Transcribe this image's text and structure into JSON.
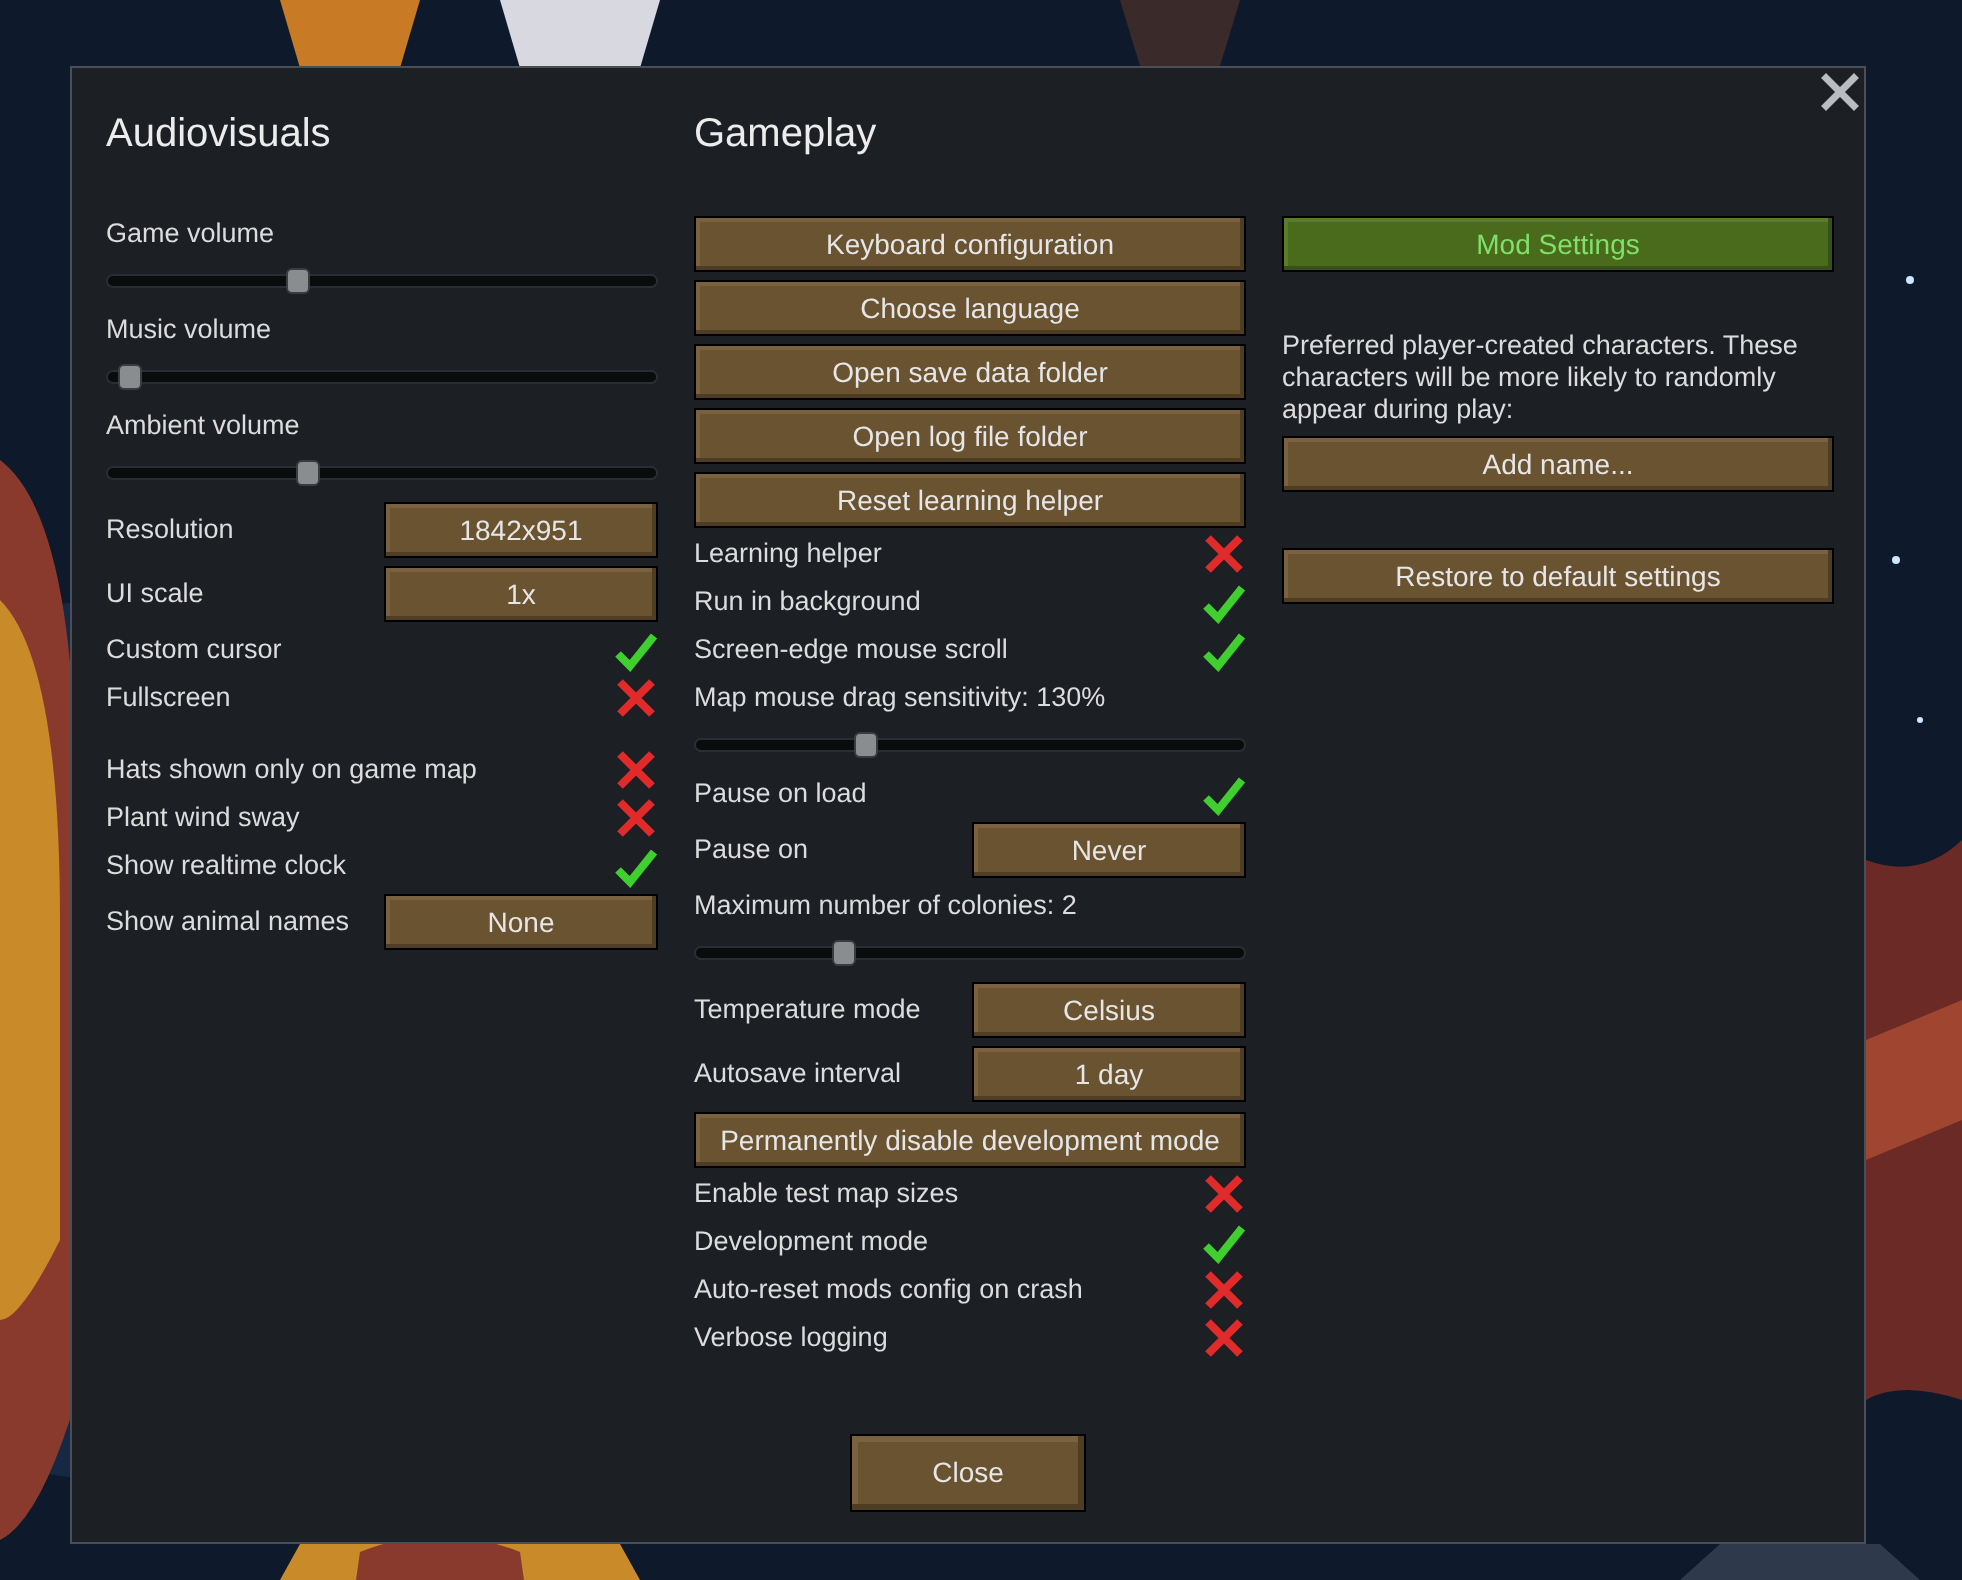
{
  "columns": [
    {
      "title": "Audiovisuals",
      "items": [
        {
          "kind": "slider",
          "label": "Game volume",
          "level": 0.34
        },
        {
          "kind": "slider",
          "label": "Music volume",
          "level": 0.02
        },
        {
          "kind": "slider",
          "label": "Ambient volume",
          "level": 0.36
        },
        {
          "kind": "dropdown",
          "label": "Resolution",
          "value": "1842x951"
        },
        {
          "kind": "dropdown",
          "label": "UI scale",
          "value": "1x"
        },
        {
          "kind": "checkbox",
          "label": "Custom cursor",
          "checked": true
        },
        {
          "kind": "checkbox",
          "label": "Fullscreen",
          "checked": false
        },
        {
          "kind": "spacer"
        },
        {
          "kind": "checkbox",
          "label": "Hats shown only on game map",
          "checked": false
        },
        {
          "kind": "checkbox",
          "label": "Plant wind sway",
          "checked": false
        },
        {
          "kind": "checkbox",
          "label": "Show realtime clock",
          "checked": true
        },
        {
          "kind": "dropdown",
          "label": "Show animal names",
          "value": "None"
        }
      ]
    },
    {
      "title": "Gameplay",
      "items": [
        {
          "kind": "button",
          "label": "Keyboard configuration"
        },
        {
          "kind": "button",
          "label": "Choose language"
        },
        {
          "kind": "button",
          "label": "Open save data folder"
        },
        {
          "kind": "button",
          "label": "Open log file folder"
        },
        {
          "kind": "button",
          "label": "Reset learning helper"
        },
        {
          "kind": "checkbox",
          "label": "Learning helper",
          "checked": false
        },
        {
          "kind": "checkbox",
          "label": "Run in background",
          "checked": true
        },
        {
          "kind": "checkbox",
          "label": "Screen-edge mouse scroll",
          "checked": true
        },
        {
          "kind": "slider",
          "label": "Map mouse drag sensitivity: 130%",
          "level": 0.3
        },
        {
          "kind": "checkbox",
          "label": "Pause on load",
          "checked": true
        },
        {
          "kind": "dropdown",
          "label": "Pause on",
          "value": "Never"
        },
        {
          "kind": "slider",
          "label": "Maximum number of colonies: 2",
          "level": 0.26
        },
        {
          "kind": "dropdown",
          "label": "Temperature mode",
          "value": "Celsius"
        },
        {
          "kind": "dropdown",
          "label": "Autosave interval",
          "value": "1 day"
        },
        {
          "kind": "button",
          "label": "Permanently disable development mode"
        },
        {
          "kind": "checkbox",
          "label": "Enable test map sizes",
          "checked": false
        },
        {
          "kind": "checkbox",
          "label": "Development mode",
          "checked": true
        },
        {
          "kind": "checkbox",
          "label": "Auto-reset mods config on crash",
          "checked": false
        },
        {
          "kind": "checkbox",
          "label": "Verbose logging",
          "checked": false
        }
      ]
    },
    {
      "items": [
        {
          "kind": "highlight_button",
          "label": "Mod Settings"
        },
        {
          "kind": "spacer"
        },
        {
          "kind": "spacer"
        },
        {
          "kind": "text",
          "text": "Preferred player-created characters. These characters will be more likely to randomly appear during play:"
        },
        {
          "kind": "button",
          "label": "Add name..."
        },
        {
          "kind": "spacer"
        },
        {
          "kind": "spacer"
        },
        {
          "kind": "button",
          "label": "Restore to default settings"
        }
      ]
    }
  ],
  "close_button": "Close"
}
